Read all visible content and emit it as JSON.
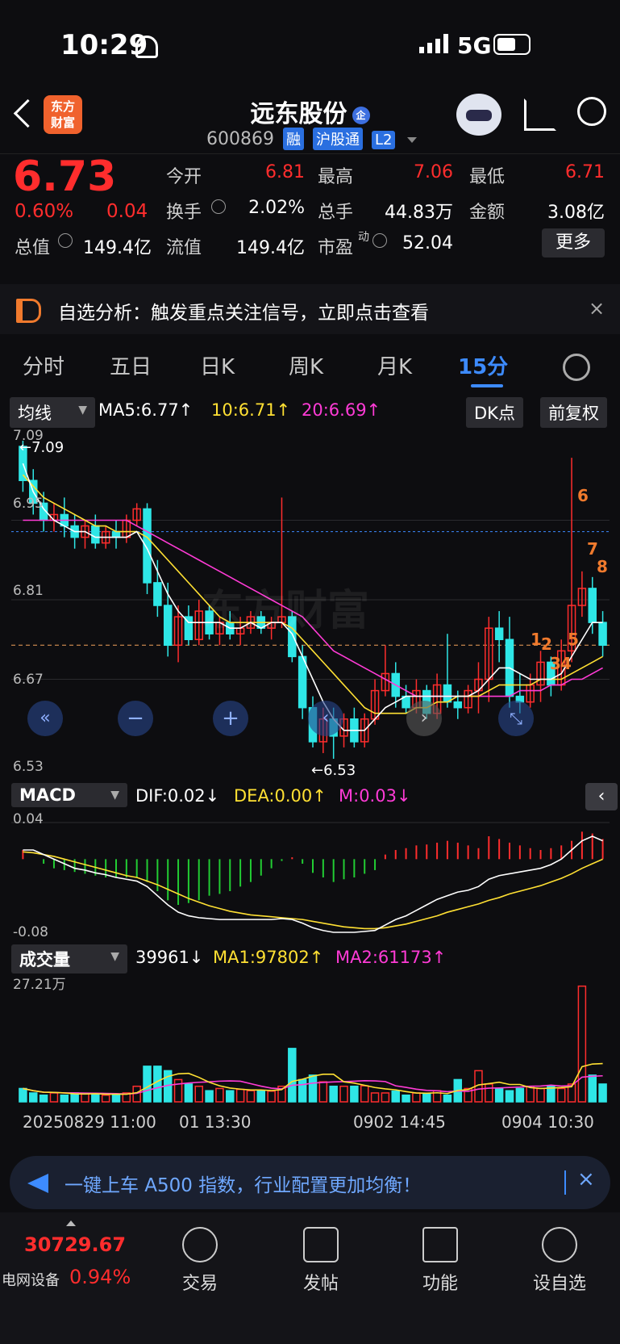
{
  "status": {
    "time": "10:29",
    "network": "5G"
  },
  "header": {
    "logo_line1": "东方",
    "logo_line2": "财富",
    "stock_name": "远东股份",
    "stock_code": "600869",
    "tags": [
      "融",
      "沪股通",
      "L2"
    ]
  },
  "quote": {
    "price": "6.73",
    "change_pct": "0.60%",
    "change": "0.04",
    "open_label": "今开",
    "open": "6.81",
    "high_label": "最高",
    "high": "7.06",
    "low_label": "最低",
    "low": "6.71",
    "turnover_label": "换手",
    "turnover": "2.02%",
    "volume_label": "总手",
    "volume": "44.83万",
    "amount_label": "金额",
    "amount": "3.08亿",
    "mktcap_label": "总值",
    "mktcap": "149.4亿",
    "float_label": "流值",
    "float_cap": "149.4亿",
    "pe_label": "市盈",
    "pe_sup": "动",
    "pe": "52.04",
    "more_button": "更多"
  },
  "notice": {
    "text": "自选分析：触发重点关注信号，立即点击查看"
  },
  "tabs": [
    "分时",
    "五日",
    "日K",
    "周K",
    "月K",
    "15分"
  ],
  "active_tab": "15分",
  "chart_bar": {
    "indicator": "均线",
    "ma5": "MA5:6.77↑",
    "ma10": "10:6.71↑",
    "ma20": "20:6.69↑",
    "dk_button": "DK点",
    "adjust_button": "前复权"
  },
  "price_axis": {
    "labels": [
      "7.09",
      "6.95",
      "6.81",
      "6.67",
      "6.53"
    ],
    "high_marker": "←7.09",
    "low_marker": "←6.53"
  },
  "watermark": "东方财富",
  "signals": [
    "1",
    "2",
    "3",
    "4",
    "5",
    "6",
    "7",
    "8"
  ],
  "macd_bar": {
    "name": "MACD",
    "dif": "DIF:0.02↓",
    "dea": "DEA:0.00↑",
    "m": "M:0.03↓"
  },
  "macd_axis": {
    "top": "0.04",
    "bottom": "-0.08"
  },
  "vol_bar": {
    "name": "成交量",
    "vol": "39961↓",
    "ma1": "MA1:97802↑",
    "ma2": "MA2:61173↑"
  },
  "vol_axis": {
    "top": "27.21万"
  },
  "dates": {
    "d1": "20250829 11:00",
    "d2": "01 13:30",
    "d3": "0902 14:45",
    "d4": "0904 10:30"
  },
  "ad": {
    "text": "一键上车 A500 指数，行业配置更加均衡！"
  },
  "bottom_nav": {
    "index_value": "30729.67",
    "index_name": "电网设备",
    "index_change": "0.94%",
    "trade": "交易",
    "post": "发帖",
    "features": "功能",
    "watchlist": "设自选"
  },
  "colors": {
    "up": "#ff2d2d",
    "down": "#2ee6e6",
    "ma5": "#ffffff",
    "ma10": "#ffe033",
    "ma20": "#ff3bd6",
    "accent": "#3d8bff"
  },
  "chart_data": {
    "type": "candlestick",
    "ylim": [
      6.53,
      7.09
    ],
    "candles": [
      [
        7.08,
        7.02,
        7.09,
        7.0
      ],
      [
        7.02,
        6.98,
        7.04,
        6.96
      ],
      [
        6.98,
        6.95,
        7.0,
        6.93
      ],
      [
        6.95,
        6.96,
        6.98,
        6.93
      ],
      [
        6.96,
        6.94,
        6.99,
        6.92
      ],
      [
        6.94,
        6.92,
        6.96,
        6.9
      ],
      [
        6.92,
        6.94,
        6.95,
        6.9
      ],
      [
        6.94,
        6.91,
        6.96,
        6.9
      ],
      [
        6.91,
        6.93,
        6.94,
        6.9
      ],
      [
        6.93,
        6.92,
        6.95,
        6.9
      ],
      [
        6.92,
        6.95,
        6.96,
        6.91
      ],
      [
        6.95,
        6.97,
        6.98,
        6.94
      ],
      [
        6.97,
        6.84,
        6.98,
        6.82
      ],
      [
        6.84,
        6.8,
        6.88,
        6.78
      ],
      [
        6.8,
        6.73,
        6.84,
        6.71
      ],
      [
        6.73,
        6.78,
        6.8,
        6.7
      ],
      [
        6.78,
        6.74,
        6.8,
        6.73
      ],
      [
        6.74,
        6.79,
        6.81,
        6.73
      ],
      [
        6.79,
        6.75,
        6.8,
        6.74
      ],
      [
        6.75,
        6.77,
        6.78,
        6.73
      ],
      [
        6.77,
        6.75,
        6.79,
        6.74
      ],
      [
        6.75,
        6.76,
        6.78,
        6.73
      ],
      [
        6.76,
        6.78,
        6.79,
        6.75
      ],
      [
        6.78,
        6.76,
        6.79,
        6.75
      ],
      [
        6.76,
        6.77,
        6.78,
        6.74
      ],
      [
        6.77,
        6.78,
        6.99,
        6.76
      ],
      [
        6.78,
        6.71,
        6.79,
        6.7
      ],
      [
        6.71,
        6.62,
        6.73,
        6.6
      ],
      [
        6.62,
        6.56,
        6.64,
        6.55
      ],
      [
        6.56,
        6.6,
        6.62,
        6.54
      ],
      [
        6.6,
        6.57,
        6.62,
        6.53
      ],
      [
        6.57,
        6.6,
        6.61,
        6.55
      ],
      [
        6.6,
        6.56,
        6.62,
        6.55
      ],
      [
        6.56,
        6.6,
        6.61,
        6.55
      ],
      [
        6.6,
        6.65,
        6.67,
        6.59
      ],
      [
        6.65,
        6.68,
        6.73,
        6.64
      ],
      [
        6.68,
        6.64,
        6.7,
        6.62
      ],
      [
        6.64,
        6.62,
        6.66,
        6.61
      ],
      [
        6.62,
        6.65,
        6.67,
        6.61
      ],
      [
        6.65,
        6.61,
        6.66,
        6.6
      ],
      [
        6.61,
        6.66,
        6.68,
        6.6
      ],
      [
        6.66,
        6.63,
        6.75,
        6.62
      ],
      [
        6.63,
        6.62,
        6.65,
        6.6
      ],
      [
        6.62,
        6.65,
        6.66,
        6.61
      ],
      [
        6.65,
        6.67,
        6.7,
        6.61
      ],
      [
        6.67,
        6.76,
        6.78,
        6.63
      ],
      [
        6.76,
        6.74,
        6.79,
        6.7
      ],
      [
        6.74,
        6.64,
        6.78,
        6.62
      ],
      [
        6.64,
        6.63,
        6.68,
        6.61
      ],
      [
        6.63,
        6.66,
        6.68,
        6.62
      ],
      [
        6.66,
        6.7,
        6.72,
        6.63
      ],
      [
        6.7,
        6.66,
        6.71,
        6.64
      ],
      [
        6.66,
        6.72,
        6.74,
        6.65
      ],
      [
        6.72,
        6.8,
        7.06,
        6.7
      ],
      [
        6.8,
        6.83,
        6.86,
        6.78
      ],
      [
        6.83,
        6.77,
        6.85,
        6.75
      ],
      [
        6.77,
        6.73,
        6.79,
        6.71
      ]
    ],
    "ma5": [
      7.05,
      7.0,
      6.97,
      6.95,
      6.94,
      6.93,
      6.93,
      6.92,
      6.92,
      6.92,
      6.92,
      6.93,
      6.9,
      6.86,
      6.82,
      6.79,
      6.77,
      6.77,
      6.77,
      6.77,
      6.76,
      6.76,
      6.77,
      6.76,
      6.77,
      6.77,
      6.75,
      6.71,
      6.67,
      6.63,
      6.6,
      6.58,
      6.58,
      6.58,
      6.6,
      6.62,
      6.63,
      6.64,
      6.64,
      6.64,
      6.64,
      6.64,
      6.64,
      6.64,
      6.65,
      6.67,
      6.69,
      6.69,
      6.68,
      6.67,
      6.67,
      6.67,
      6.68,
      6.71,
      6.74,
      6.77,
      6.77
    ],
    "ma10": [
      7.03,
      7.01,
      6.99,
      6.98,
      6.97,
      6.96,
      6.95,
      6.94,
      6.94,
      6.93,
      6.93,
      6.93,
      6.92,
      6.9,
      6.88,
      6.86,
      6.84,
      6.82,
      6.8,
      6.78,
      6.77,
      6.77,
      6.77,
      6.77,
      6.77,
      6.77,
      6.76,
      6.74,
      6.72,
      6.7,
      6.68,
      6.66,
      6.64,
      6.62,
      6.61,
      6.61,
      6.61,
      6.61,
      6.62,
      6.62,
      6.63,
      6.63,
      6.64,
      6.64,
      6.64,
      6.65,
      6.66,
      6.66,
      6.66,
      6.66,
      6.67,
      6.67,
      6.67,
      6.68,
      6.69,
      6.7,
      6.71
    ],
    "ma20": [
      6.95,
      6.95,
      6.95,
      6.95,
      6.95,
      6.95,
      6.95,
      6.95,
      6.95,
      6.95,
      6.95,
      6.94,
      6.93,
      6.92,
      6.91,
      6.9,
      6.89,
      6.88,
      6.87,
      6.86,
      6.85,
      6.84,
      6.83,
      6.82,
      6.81,
      6.8,
      6.79,
      6.78,
      6.76,
      6.74,
      6.72,
      6.71,
      6.7,
      6.69,
      6.68,
      6.67,
      6.66,
      6.65,
      6.64,
      6.64,
      6.64,
      6.64,
      6.64,
      6.64,
      6.64,
      6.64,
      6.64,
      6.64,
      6.65,
      6.65,
      6.65,
      6.66,
      6.66,
      6.67,
      6.67,
      6.68,
      6.69
    ],
    "macd_ylim": [
      -0.08,
      0.04
    ],
    "macd_hist": [
      0.01,
      0.0,
      -0.005,
      -0.01,
      -0.012,
      -0.014,
      -0.016,
      -0.018,
      -0.02,
      -0.02,
      -0.02,
      -0.02,
      -0.025,
      -0.035,
      -0.045,
      -0.05,
      -0.048,
      -0.045,
      -0.04,
      -0.038,
      -0.035,
      -0.03,
      -0.025,
      -0.018,
      -0.01,
      -0.002,
      0.002,
      -0.005,
      -0.015,
      -0.02,
      -0.025,
      -0.022,
      -0.02,
      -0.016,
      -0.012,
      0.005,
      0.01,
      0.012,
      0.015,
      0.016,
      0.018,
      0.02,
      0.018,
      0.015,
      0.012,
      0.025,
      0.022,
      0.018,
      0.015,
      0.012,
      0.01,
      0.012,
      0.015,
      0.02,
      0.03,
      0.028,
      0.022
    ],
    "dif": [
      0.01,
      0.01,
      0.005,
      0.0,
      -0.005,
      -0.01,
      -0.012,
      -0.015,
      -0.017,
      -0.02,
      -0.022,
      -0.024,
      -0.03,
      -0.04,
      -0.05,
      -0.058,
      -0.062,
      -0.064,
      -0.065,
      -0.066,
      -0.066,
      -0.066,
      -0.066,
      -0.066,
      -0.066,
      -0.065,
      -0.066,
      -0.07,
      -0.075,
      -0.078,
      -0.08,
      -0.08,
      -0.08,
      -0.079,
      -0.078,
      -0.072,
      -0.066,
      -0.062,
      -0.056,
      -0.05,
      -0.044,
      -0.04,
      -0.036,
      -0.034,
      -0.03,
      -0.022,
      -0.018,
      -0.016,
      -0.014,
      -0.012,
      -0.01,
      -0.006,
      0.0,
      0.01,
      0.02,
      0.025,
      0.02
    ],
    "dea": [
      0.008,
      0.007,
      0.005,
      0.003,
      0.0,
      -0.003,
      -0.006,
      -0.009,
      -0.012,
      -0.015,
      -0.018,
      -0.02,
      -0.024,
      -0.028,
      -0.033,
      -0.038,
      -0.043,
      -0.047,
      -0.051,
      -0.054,
      -0.057,
      -0.059,
      -0.061,
      -0.062,
      -0.063,
      -0.064,
      -0.065,
      -0.066,
      -0.068,
      -0.07,
      -0.072,
      -0.074,
      -0.075,
      -0.076,
      -0.076,
      -0.075,
      -0.073,
      -0.071,
      -0.068,
      -0.065,
      -0.062,
      -0.058,
      -0.055,
      -0.052,
      -0.049,
      -0.045,
      -0.042,
      -0.038,
      -0.035,
      -0.032,
      -0.029,
      -0.025,
      -0.021,
      -0.016,
      -0.01,
      -0.005,
      0.0
    ],
    "volume_ylim": [
      0,
      27.21
    ],
    "volume": [
      3,
      2,
      1.5,
      2,
      1.5,
      2,
      1.8,
      1.8,
      1.5,
      1.5,
      2,
      3.5,
      8,
      8,
      7,
      5,
      4,
      3.5,
      2.5,
      3,
      2.5,
      2.8,
      2.5,
      2.5,
      2.4,
      3.5,
      12,
      5,
      6,
      4.5,
      3.5,
      3.5,
      3.5,
      3.6,
      2,
      2,
      2.4,
      1.5,
      2,
      1.8,
      2.5,
      1.5,
      5,
      3,
      7,
      4,
      3,
      2.5,
      3,
      3.5,
      3,
      3.5,
      3,
      4,
      26,
      6,
      4
    ]
  }
}
